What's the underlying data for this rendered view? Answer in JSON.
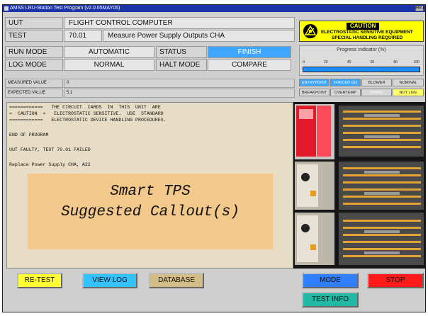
{
  "window": {
    "title": "AMSS LRU-Station Test Program (v2.0.05MAY05)",
    "close_label": "REJ"
  },
  "uut": {
    "label": "UUT",
    "value": "FLIGHT CONTROL COMPUTER"
  },
  "test": {
    "label": "TEST",
    "number": "70.01",
    "name": "Measure Power Supply Outputs CHA"
  },
  "run_mode": {
    "label": "RUN MODE",
    "value": "AUTOMATIC"
  },
  "status": {
    "label": "STATUS",
    "value": "FINISH",
    "color": "#3ea6ff"
  },
  "log_mode": {
    "label": "LOG MODE",
    "value": "NORMAL"
  },
  "halt_mode": {
    "label": "HALT MODE",
    "value": "COMPARE"
  },
  "measured": {
    "label": "MEASURED VALUE",
    "value": "0"
  },
  "expected": {
    "label": "EXPECTED VALUE",
    "value": "5.1"
  },
  "caution": {
    "word": "CAUTION",
    "line1": "ELECTROSTATIC SENSITIVE EQUIPMENT",
    "line2": "SPECIAL HANDLING REQUIRED",
    "icon": "esd-warning-icon"
  },
  "progress": {
    "title": "Progress Indicator (%)",
    "ticks": [
      "0",
      "20",
      "40",
      "60",
      "80",
      "100"
    ],
    "percent": 100
  },
  "indicators": {
    "row1": [
      "ENTRYPOINT",
      "FORCED GO",
      "BLOWER",
      "NOMINAL"
    ],
    "row2": [
      "BREAKPOINT",
      "OVERTEMP",
      "SPARE",
      "NOT LIVE"
    ]
  },
  "output": {
    "lines": [
      "============   THE CIRCUIT  CARDS  IN  THIS  UNIT  ARE",
      "=  CAUTION  =   ELECTROSTATIC SENSITIVE.  USE  STANDARD",
      "============   ELECTROSTATIC DEVICE HANDLING PROCEDURES.",
      "",
      "END OF PROGRAM",
      "",
      "UUT FAULTY, TEST 70.01 FAILED",
      "",
      "Replace Power Supply CHA, A22"
    ]
  },
  "callout": {
    "line1": "Smart TPS",
    "line2": "Suggested Callout(s)"
  },
  "buttons": {
    "retest": "RE-TEST",
    "view_log": "VIEW LOG",
    "database": "DATABASE",
    "mode": "MODE",
    "stop": "STOP",
    "test_info": "TEST INFO"
  }
}
